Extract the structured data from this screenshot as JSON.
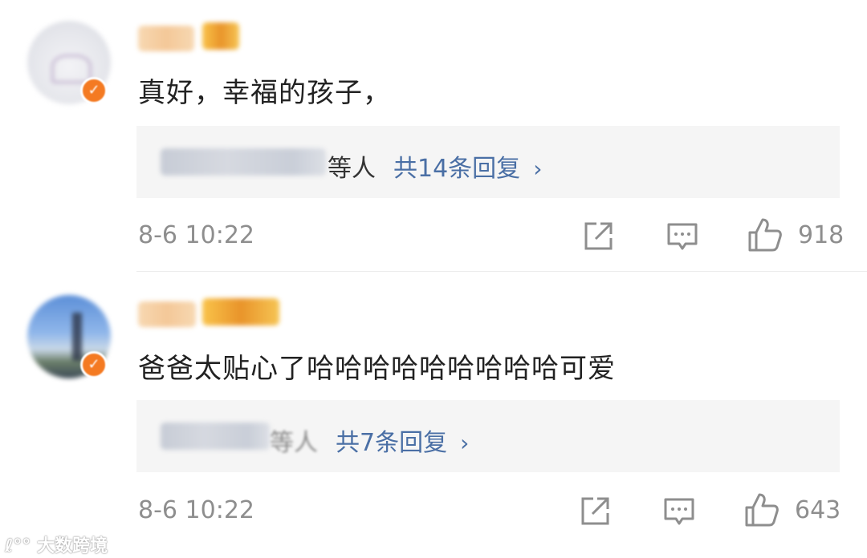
{
  "comments": [
    {
      "text": "真好，幸福的孩子，",
      "reply_suffix": "等人",
      "reply_count_label": "共14条回复",
      "chevron": "›",
      "time": "8-6 10:22",
      "likes": "918",
      "badge_icon": "check-icon"
    },
    {
      "text": "爸爸太贴心了哈哈哈哈哈哈哈哈哈可爱",
      "reply_suffix": "等人",
      "reply_count_label": "共7条回复",
      "chevron": "›",
      "time": "8-6 10:22",
      "likes": "643",
      "badge_icon": "check-icon"
    }
  ],
  "watermark": "大数跨境",
  "colors": {
    "link": "#4a6fa5",
    "meta": "#8e8e8e",
    "badge": "#f47a22",
    "reply_bg": "#f5f5f5"
  }
}
